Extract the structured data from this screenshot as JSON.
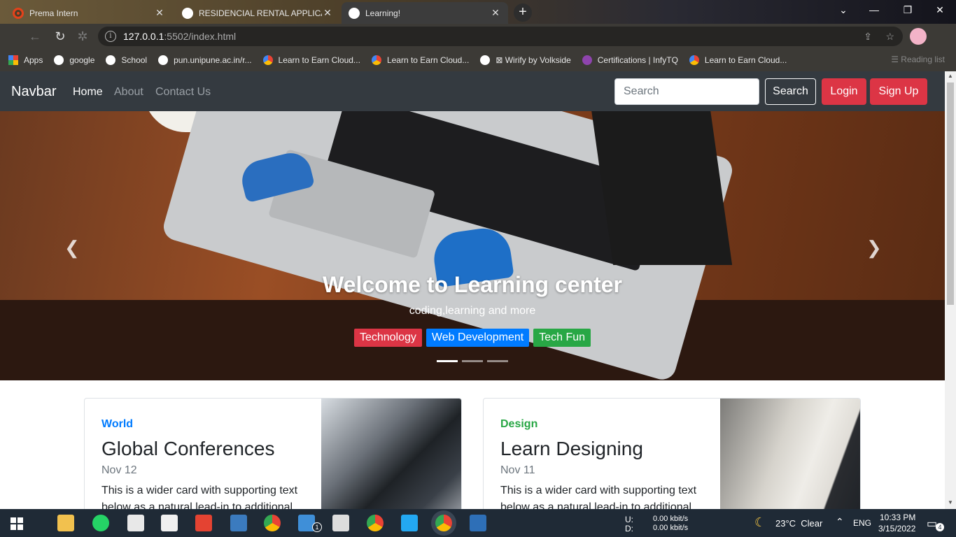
{
  "browser": {
    "tabs": [
      {
        "title": "Prema Intern",
        "active": false
      },
      {
        "title": "RESIDENCIAL RENTAL APPLICATI",
        "active": false
      },
      {
        "title": "Learning!",
        "active": true
      }
    ],
    "url_host": "127.0.0.1",
    "url_path": ":5502/index.html",
    "bookmarks": [
      {
        "label": "Apps",
        "icon": "apps-grid-icon"
      },
      {
        "label": "google",
        "icon": "globe-icon"
      },
      {
        "label": "School",
        "icon": "globe-icon"
      },
      {
        "label": "pun.unipune.ac.in/r...",
        "icon": "globe-icon"
      },
      {
        "label": "Learn to Earn Cloud...",
        "icon": "google-cloud-icon"
      },
      {
        "label": "Learn to Earn Cloud...",
        "icon": "google-cloud-icon"
      },
      {
        "label": "⊠ Wirify by Volkside",
        "icon": "globe-icon"
      },
      {
        "label": "Certifications | InfyTQ",
        "icon": "infytq-icon"
      },
      {
        "label": "Learn to Earn Cloud...",
        "icon": "google-cloud-icon"
      }
    ],
    "reading_list": "Reading list"
  },
  "navbar": {
    "brand": "Navbar",
    "links": [
      "Home",
      "About",
      "Contact Us"
    ],
    "search_placeholder": "Search",
    "search_button": "Search",
    "login_button": "Login",
    "signup_button": "Sign Up"
  },
  "carousel": {
    "title": "Welcome to Learning center",
    "subtitle": "coding,learning and more",
    "badges": [
      {
        "label": "Technology",
        "color": "#dc3545"
      },
      {
        "label": "Web Development",
        "color": "#007bff"
      },
      {
        "label": "Tech Fun",
        "color": "#28a745"
      }
    ],
    "active_slide": 1,
    "slides": 3
  },
  "cards": [
    {
      "category": "World",
      "category_color": "#007bff",
      "title": "Global Conferences",
      "date": "Nov 12",
      "text": "This is a wider card with supporting text below as a natural lead-in to additional"
    },
    {
      "category": "Design",
      "category_color": "#28a745",
      "title": "Learn Designing",
      "date": "Nov 11",
      "text": "This is a wider card with supporting text below as a natural lead-in to additional"
    }
  ],
  "taskbar": {
    "net_up_label": "U:",
    "net_down_label": "D:",
    "net_up": "0.00 kbit/s",
    "net_down": "0.00 kbit/s",
    "weather": "23°C  Clear",
    "lang": "ENG",
    "time": "10:33 PM",
    "date": "3/15/2022",
    "notifications": "4",
    "mail_badge": "1"
  }
}
